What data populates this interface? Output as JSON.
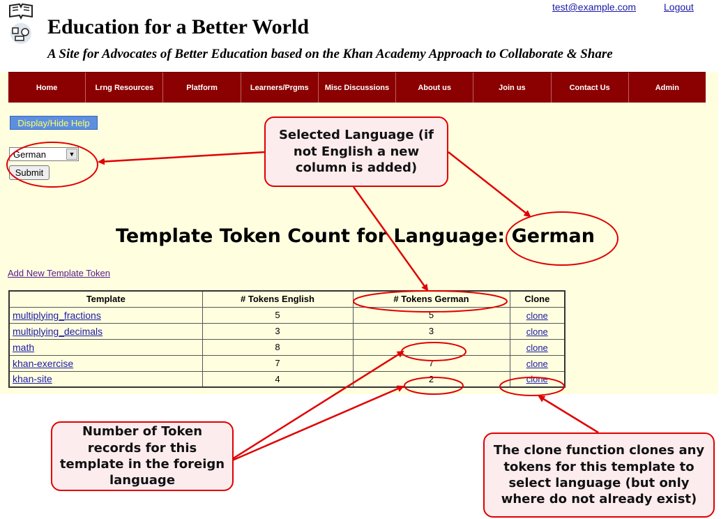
{
  "header": {
    "title": "Education for a Better World",
    "subtitle": "A Site for Advocates of Better Education based on the Khan Academy Approach to Collaborate & Share",
    "user_email": "test@example.com",
    "logout": "Logout"
  },
  "nav": [
    "Home",
    "Lrng Resources",
    "Platform",
    "Learners/Prgms",
    "Misc Discussions",
    "About us",
    "Join us",
    "Contact Us",
    "Admin"
  ],
  "help_button": "Display/Hide Help",
  "language_select": {
    "value": "German"
  },
  "submit": "Submit",
  "page_title": "Template Token Count for Language: German",
  "add_link": "Add New Template Token",
  "table": {
    "headers": [
      "Template",
      "# Tokens English",
      "# Tokens German",
      "Clone"
    ],
    "rows": [
      {
        "template": "multiplying_fractions",
        "english": "5",
        "foreign": "5",
        "clone": "clone"
      },
      {
        "template": "multiplying_decimals",
        "english": "3",
        "foreign": "3",
        "clone": "clone"
      },
      {
        "template": "math",
        "english": "8",
        "foreign": "",
        "clone": "clone"
      },
      {
        "template": "khan-exercise",
        "english": "7",
        "foreign": "7",
        "clone": "clone"
      },
      {
        "template": "khan-site",
        "english": "4",
        "foreign": "2",
        "clone": "clone"
      }
    ]
  },
  "callouts": {
    "language": "Selected Language (if not English a new column is added)",
    "token_count": "Number of Token records for this template in the foreign language",
    "clone": "The clone function clones any tokens for this template to select language (but only where do not already exist)"
  },
  "colors": {
    "page_bg": "#ffffe0",
    "nav_bg": "#8b0000",
    "annotation_red": "#e00000",
    "callout_bg": "#fcecee",
    "help_button_bg": "#5c8fe0"
  }
}
